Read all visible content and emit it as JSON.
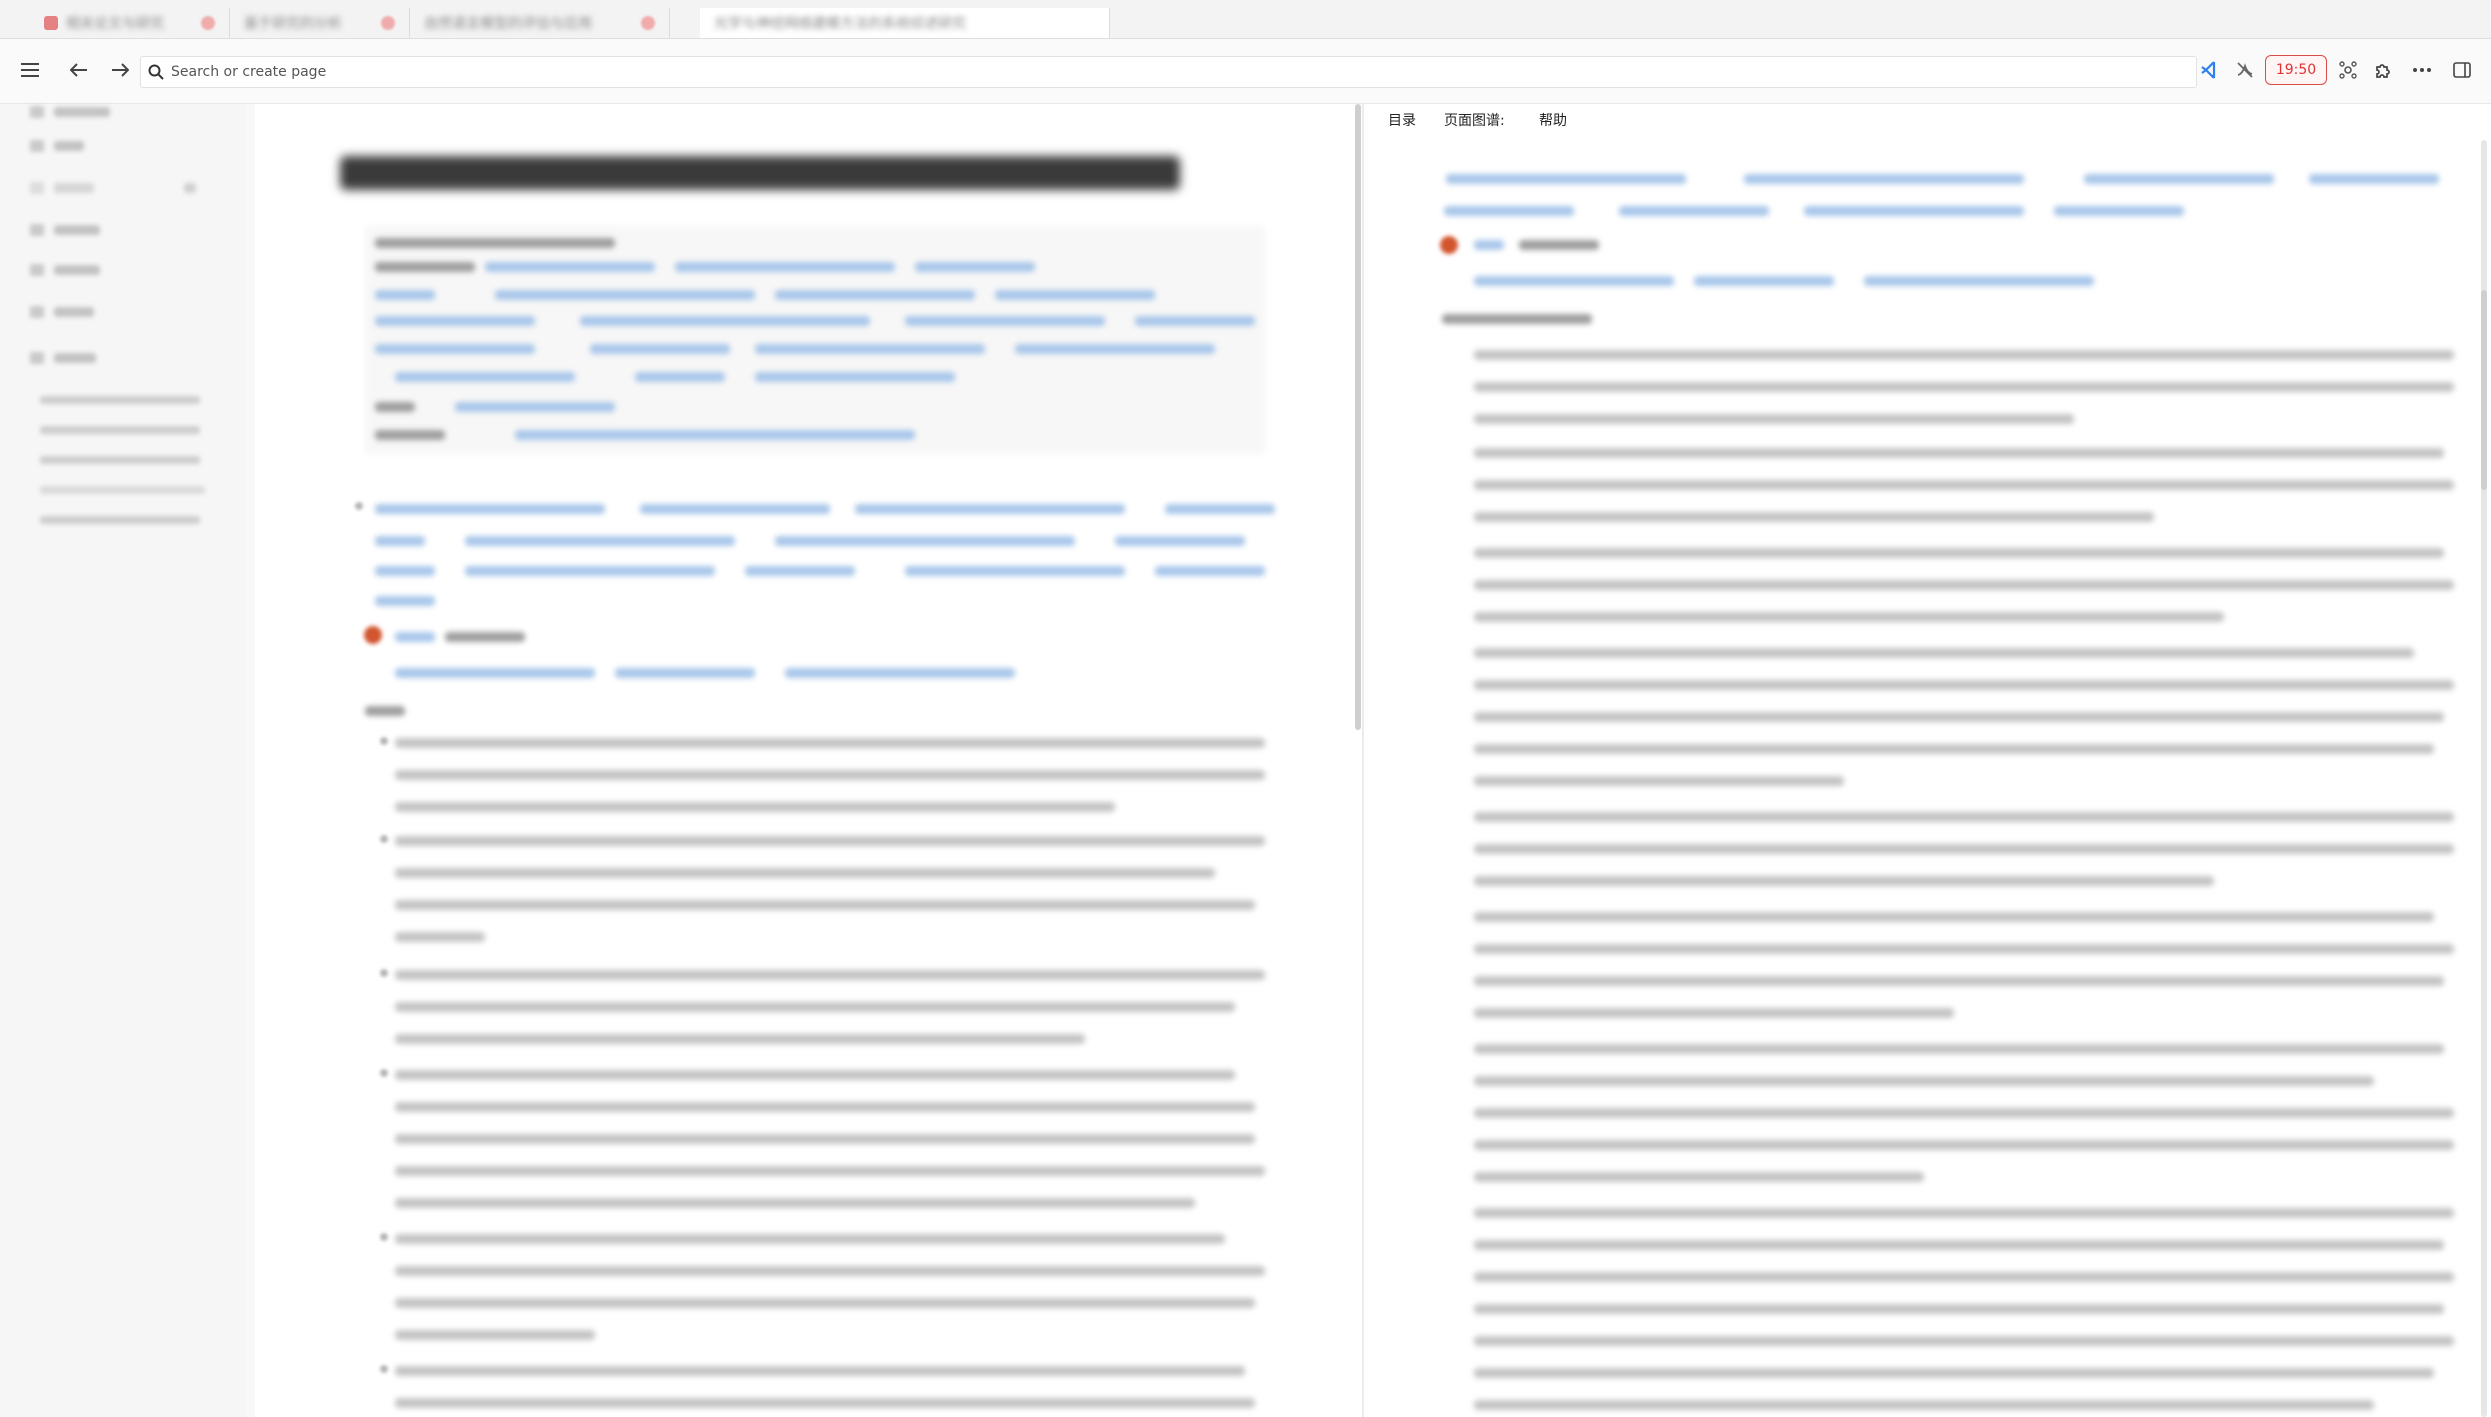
{
  "tabs": [
    {
      "title": "相关论文与研究"
    },
    {
      "title": "基于研究的分析"
    },
    {
      "title": "自然语言模型的评估与应用"
    },
    {
      "title": "光学与神经网络建模方法的系统综述研究"
    }
  ],
  "toolbar": {
    "search_placeholder": "Search or create page",
    "timer": "19:50"
  },
  "right_panel": {
    "tabs": [
      "目录",
      "页面图谱:",
      "帮助"
    ]
  },
  "colors": {
    "accent": "#2f80ed",
    "timer_border": "#d94c4c",
    "link_blue": "#a8c6ea"
  }
}
